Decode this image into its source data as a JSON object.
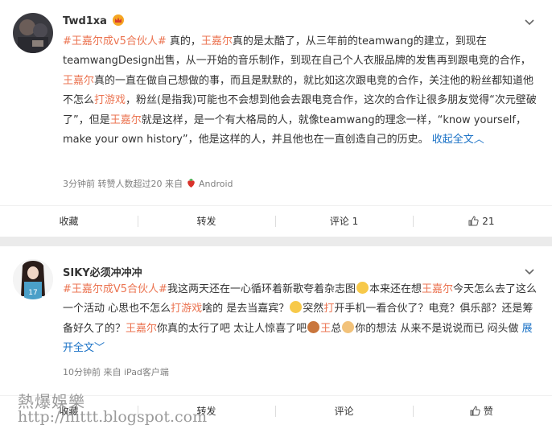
{
  "post1": {
    "username": "Twd1xa",
    "verified_badge": "crown-badge",
    "text_segments": [
      {
        "t": "#王嘉尔成v5合伙人#",
        "c": "tl"
      },
      {
        "t": " 真的，",
        "c": ""
      },
      {
        "t": "王嘉尔",
        "c": "tl"
      },
      {
        "t": "真的是太酷了，从三年前的teamwang的建立，到现在teamwangDesign出售，从一开始的音乐制作，到现在自己个人衣服品牌的发售再到跟电竞的合作，",
        "c": ""
      },
      {
        "t": "王嘉尔",
        "c": "tl"
      },
      {
        "t": "真的一直在做自己想做的事，而且是默默的，就比如这次跟电竞的合作，关注他的粉丝都知道他不怎么",
        "c": ""
      },
      {
        "t": "打游戏",
        "c": "tl"
      },
      {
        "t": "，粉丝(是指我)可能也不会想到他会去跟电竞合作，这次的合作让很多朋友觉得“次元壁破了”，但是",
        "c": ""
      },
      {
        "t": "王嘉尔",
        "c": "tl"
      },
      {
        "t": "就是这样，是一个有大格局的人，就像teamwang的理念一样，“know yourself，make your own history”，他是这样的人，并且他也在一直创造自己的历史。",
        "c": ""
      },
      {
        "t": " 收起全文",
        "c": "blue"
      },
      {
        "t": "︿",
        "c": "blue"
      }
    ],
    "meta": {
      "time": "3分钟前",
      "repost_info": "转赞人数超过20",
      "source_prefix": "来自",
      "source": "Android"
    },
    "actions": {
      "fav": "收藏",
      "repost": "转发",
      "comment": "评论 1",
      "like": "21"
    }
  },
  "post2": {
    "username": "SIKY必须冲冲冲",
    "text_segments": [
      {
        "t": "#王嘉尔成V5合伙人#",
        "c": "tl"
      },
      {
        "t": "我这两天还在一心循环着新歌夸着杂志图",
        "c": ""
      },
      {
        "t": "E1",
        "c": "emoji"
      },
      {
        "t": "本来还在想",
        "c": ""
      },
      {
        "t": "王嘉尔",
        "c": "tl"
      },
      {
        "t": "今天怎么去了这么一个活动 心思也不怎么",
        "c": ""
      },
      {
        "t": "打游戏",
        "c": "tl"
      },
      {
        "t": "啥的 是去当嘉宾？",
        "c": ""
      },
      {
        "t": "E1",
        "c": "emoji"
      },
      {
        "t": "突然",
        "c": ""
      },
      {
        "t": "打",
        "c": "tl"
      },
      {
        "t": "开手机一看合伙了？电竞？俱乐部？还是筹备好久了的？",
        "c": ""
      },
      {
        "t": "王嘉尔",
        "c": "tl"
      },
      {
        "t": "你真的太行了吧 太让人惊喜了吧",
        "c": ""
      },
      {
        "t": "E2",
        "c": "emoji"
      },
      {
        "t": "王",
        "c": "tl"
      },
      {
        "t": "总",
        "c": ""
      },
      {
        "t": "E3",
        "c": "emoji"
      },
      {
        "t": "你的想法 从来不是说说而已 闷头做 ",
        "c": ""
      },
      {
        "t": "展开全文",
        "c": "blue"
      },
      {
        "t": "﹀",
        "c": "blue"
      }
    ],
    "meta": {
      "time": "10分钟前",
      "source_prefix": "来自",
      "source": "iPad客户端"
    },
    "actions": {
      "fav": "收藏",
      "repost": "转发",
      "comment": "评论",
      "like": "赞"
    }
  },
  "watermark": {
    "line1": "熱爆娛樂",
    "line2": "http://hittt.blogspot.com"
  },
  "colors": {
    "topic": "#eb7350",
    "link": "#1b72c6",
    "meta": "#808080"
  }
}
